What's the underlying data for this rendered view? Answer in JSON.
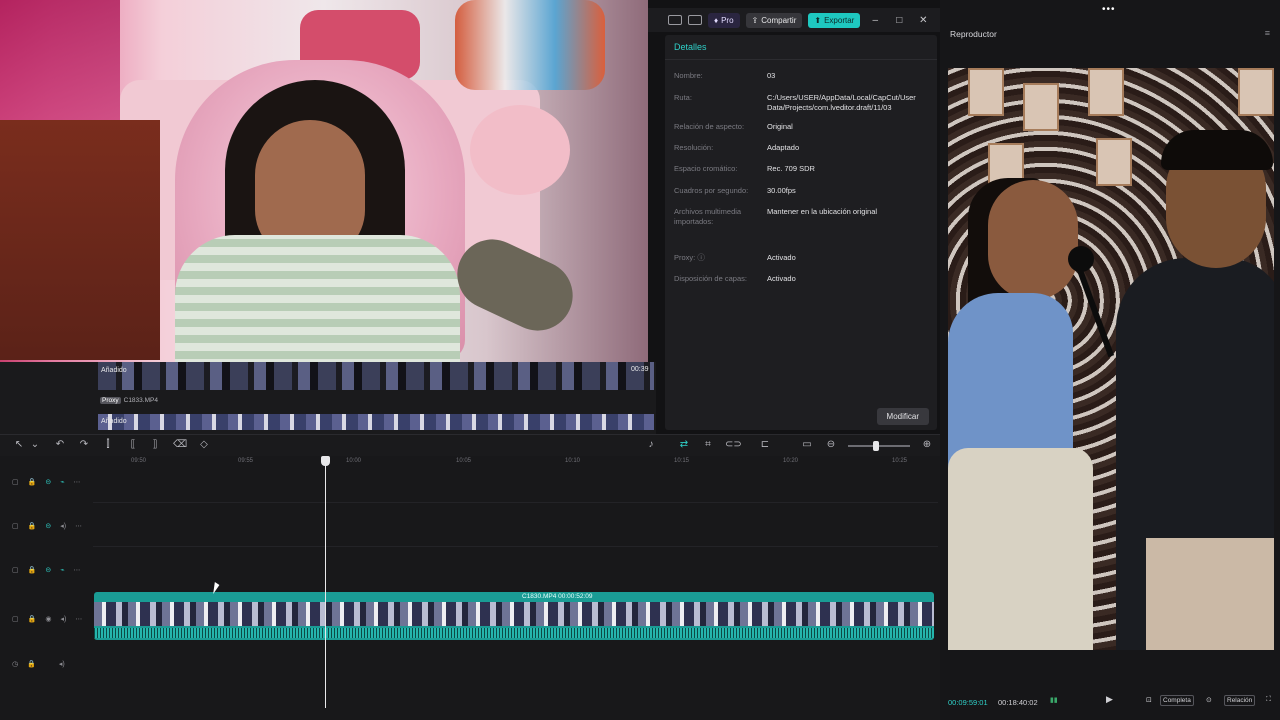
{
  "titlebar": {
    "pro_label": "Pro",
    "share_label": "Compartir",
    "export_label": "Exportar",
    "minimize": "–",
    "maximize": "□",
    "close": "✕"
  },
  "details": {
    "title": "Detalles",
    "rows": [
      {
        "key": "Nombre:",
        "value": "03"
      },
      {
        "key": "Ruta:",
        "value": "C:/Users/USER/AppData/Local/CapCut/User Data/Projects/com.lveditor.draft/11/03"
      },
      {
        "key": "Relación de aspecto:",
        "value": "Original"
      },
      {
        "key": "Resolución:",
        "value": "Adaptado"
      },
      {
        "key": "Espacio cromático:",
        "value": "Rec. 709 SDR"
      },
      {
        "key": "Cuadros por segundo:",
        "value": "30.00fps"
      },
      {
        "key": "Archivos multimedia importados:",
        "value": "Mantener en la ubicación original"
      },
      {
        "key": "Proxy: ⓘ",
        "value": "Activado"
      },
      {
        "key": "Disposición de capas:",
        "value": "Activado"
      }
    ],
    "modify_label": "Modificar"
  },
  "media": {
    "strip1_label": "Añadido",
    "strip1_duration": "00:39",
    "proxy_tag": "Proxy",
    "proxy_file": "C1833.MP4",
    "strip2_label": "Añadido"
  },
  "timeline": {
    "ruler_ticks": [
      "09:50",
      "09:55",
      "10:00",
      "10:05",
      "10:10",
      "10:15",
      "10:20",
      "10:25"
    ],
    "clip_label": "C1830.MP4   00:00:52:09"
  },
  "player": {
    "title": "Reproductor",
    "menu_icon": "≡",
    "current_time": "00:09:59:01",
    "total_time": "00:18:40:02",
    "full_label": "Completa",
    "ratio_label": "Relación"
  }
}
